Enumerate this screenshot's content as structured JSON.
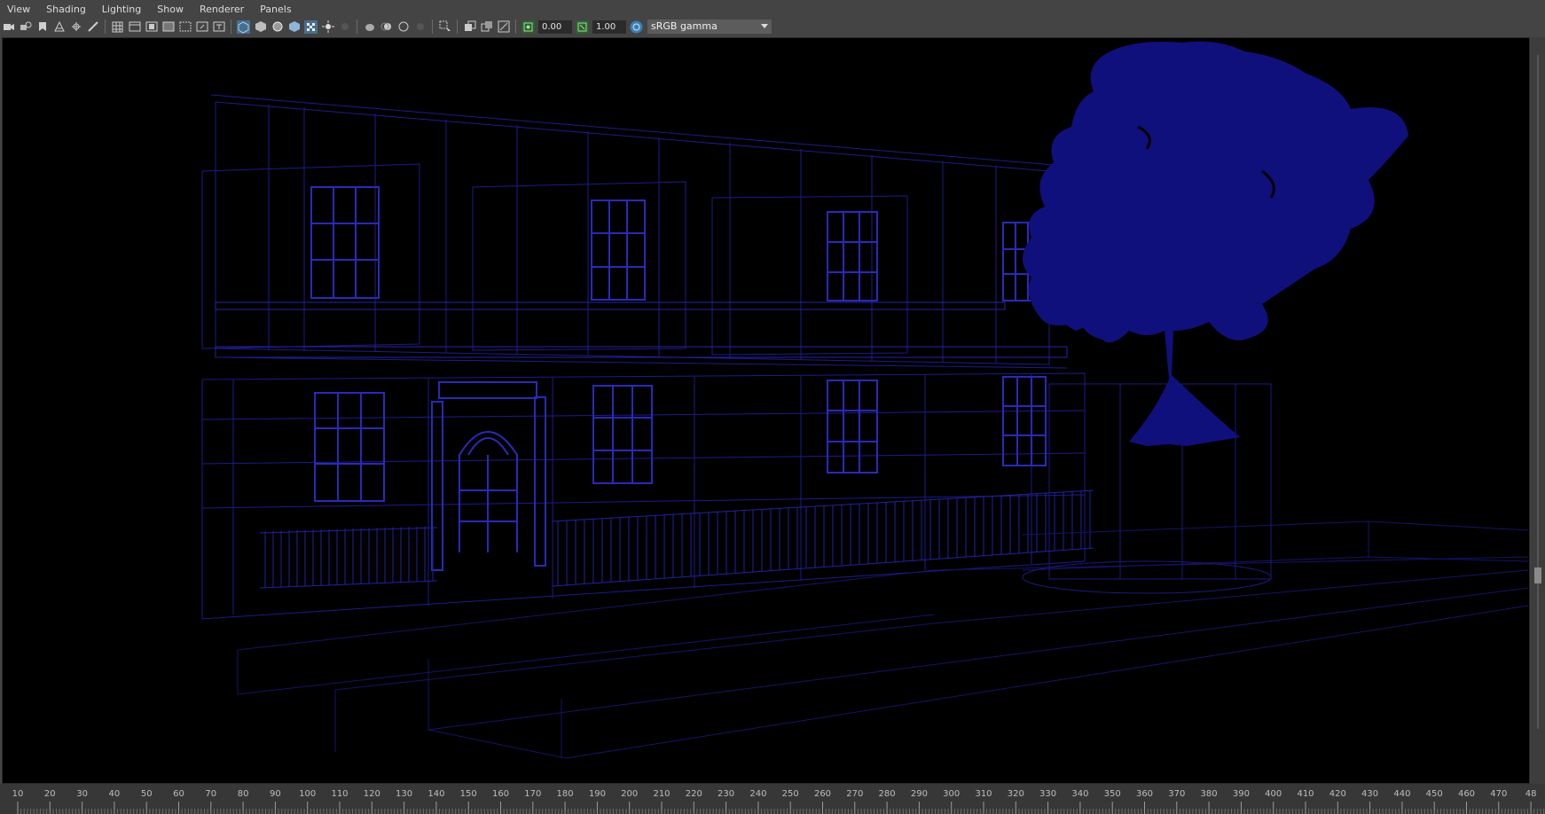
{
  "menu": {
    "items": [
      "View",
      "Shading",
      "Lighting",
      "Show",
      "Renderer",
      "Panels"
    ]
  },
  "toolbar": {
    "icons": [
      "camera-icon",
      "camera-attributes-icon",
      "bookmark-icon",
      "image-plane-icon",
      "2d-pan-zoom-icon",
      "grease-pencil-icon",
      "grid-icon",
      "film-gate-icon",
      "resolution-gate-icon",
      "gate-mask-icon",
      "field-chart-icon",
      "safe-action-icon",
      "safe-title-icon",
      "wireframe-icon",
      "smooth-shade-icon",
      "wireframe-on-shaded-icon",
      "use-default-material-icon",
      "textured-icon",
      "lighting-icon",
      "shadows-icon",
      "screen-space-ao-icon",
      "motion-blur-icon",
      "multisample-aa-icon",
      "depth-of-field-icon",
      "isolate-select-icon",
      "xray-icon",
      "xray-joints-icon",
      "xray-components-icon",
      "exposure-icon",
      "gamma-icon",
      "color-management-icon"
    ],
    "exposure_value": "0.00",
    "gamma_value": "1.00",
    "view_transform": "sRGB gamma",
    "active_color": "#5aa0e0"
  },
  "viewport": {
    "background": "#000000",
    "wire_color": "#1c1c8c",
    "wire_color_dim": "#12125a"
  },
  "timeline": {
    "ticks": [
      "10",
      "20",
      "30",
      "40",
      "50",
      "60",
      "70",
      "80",
      "90",
      "100",
      "110",
      "120",
      "130",
      "140",
      "150",
      "160",
      "170",
      "180",
      "190",
      "200",
      "210",
      "220",
      "230",
      "240",
      "250",
      "260",
      "270",
      "280",
      "290",
      "300",
      "310",
      "320",
      "330",
      "340",
      "350",
      "360",
      "370",
      "380",
      "390",
      "400",
      "410",
      "420",
      "430",
      "440",
      "450",
      "460",
      "470",
      "48"
    ]
  }
}
